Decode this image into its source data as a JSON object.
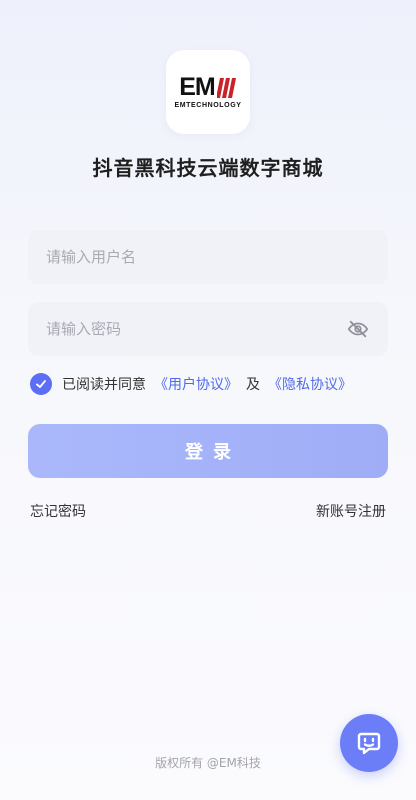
{
  "logo": {
    "mark": "EM",
    "subtitle": "EMTECHNOLOGY",
    "icon": "em-logo"
  },
  "app_title": "抖音黑科技云端数字商城",
  "form": {
    "username": {
      "placeholder": "请输入用户名",
      "value": ""
    },
    "password": {
      "placeholder": "请输入密码",
      "value": "",
      "toggle_icon": "eye-off-icon"
    },
    "agreement": {
      "checked": true,
      "prefix": "已阅读并同意",
      "user_agreement": "《用户协议》",
      "and": "及",
      "privacy_policy": "《隐私协议》"
    },
    "login_label": "登录"
  },
  "links": {
    "forgot_password": "忘记密码",
    "register": "新账号注册"
  },
  "footer": "版权所有 @EM科技",
  "chat_icon": "chat-bot-icon",
  "colors": {
    "accent": "#5b6ef5",
    "link": "#4f6bea",
    "button": "#a5b3f9"
  }
}
